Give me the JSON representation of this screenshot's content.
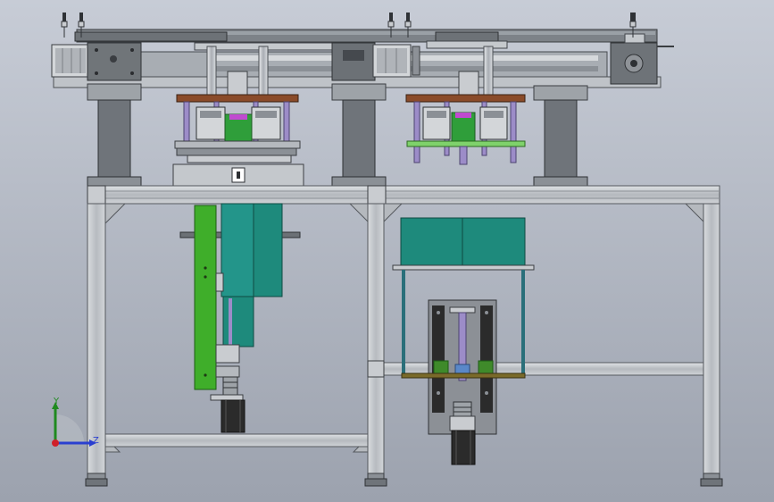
{
  "viewport": {
    "background_top": "#c7ccd6",
    "background_bottom": "#9ca2ae"
  },
  "colors": {
    "frame_aluminum": "#bfc3c8",
    "frame_shadow": "#8c9096",
    "dark_steel": "#6f747a",
    "gray_block": "#9ea3a8",
    "teal": "#1e8a7c",
    "green": "#3fae2a",
    "wood_plate": "#8a4b2a",
    "purple_rod": "#9c8cc8",
    "black": "#2b2b2b",
    "bright_green_plate": "#7fd26b"
  },
  "triad": {
    "y_label": "Y",
    "z_label": "Z"
  }
}
